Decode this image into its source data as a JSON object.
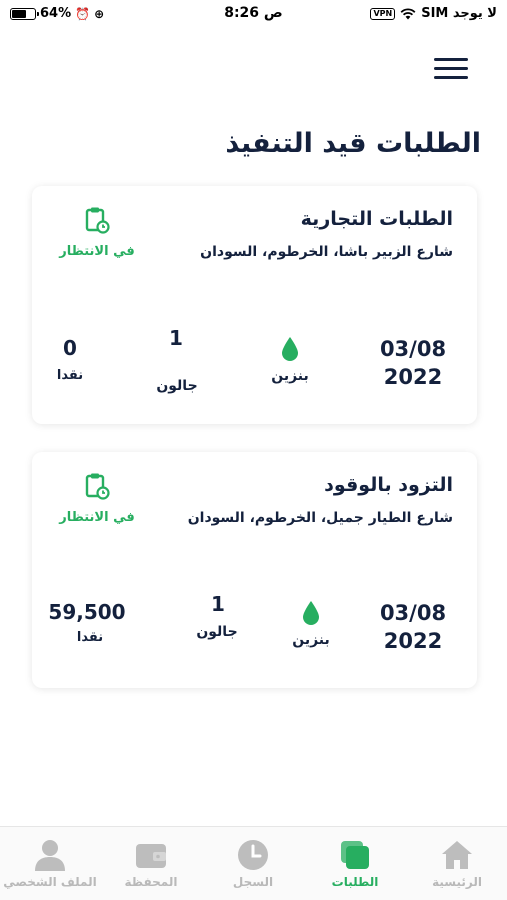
{
  "status_bar": {
    "battery": "64%",
    "time": "8:26 ص",
    "vpn": "VPN",
    "carrier": "لا يوجد SIM"
  },
  "page": {
    "title": "الطلبات قيد التنفيذ"
  },
  "orders": [
    {
      "title": "الطلبات التجارية",
      "address": "شارع الزبير باشا، الخرطوم، السودان",
      "status": "في الانتظار",
      "date_line1": "03/08",
      "date_line2": "2022",
      "fuel": "بنزين",
      "quantity": "1",
      "quantity_unit": "جالون",
      "amount": "0",
      "payment": "نقدا"
    },
    {
      "title": "التزود بالوقود",
      "address": "شارع الطيار جميل، الخرطوم، السودان",
      "status": "في الانتظار",
      "date_line1": "03/08",
      "date_line2": "2022",
      "fuel": "بنزين",
      "quantity": "1",
      "quantity_unit": "جالون",
      "amount": "59,500",
      "payment": "نقدا"
    }
  ],
  "tabs": [
    {
      "label": "الرئيسية",
      "icon": "home-icon",
      "active": false
    },
    {
      "label": "الطلبات",
      "icon": "orders-icon",
      "active": true
    },
    {
      "label": "السجل",
      "icon": "clock-icon",
      "active": false
    },
    {
      "label": "المحفظة",
      "icon": "wallet-icon",
      "active": false
    },
    {
      "label": "الملف الشخصي",
      "icon": "user-icon",
      "active": false
    }
  ],
  "colors": {
    "accent": "#27ae60",
    "text": "#14213d",
    "inactive": "#b9b9b9"
  }
}
